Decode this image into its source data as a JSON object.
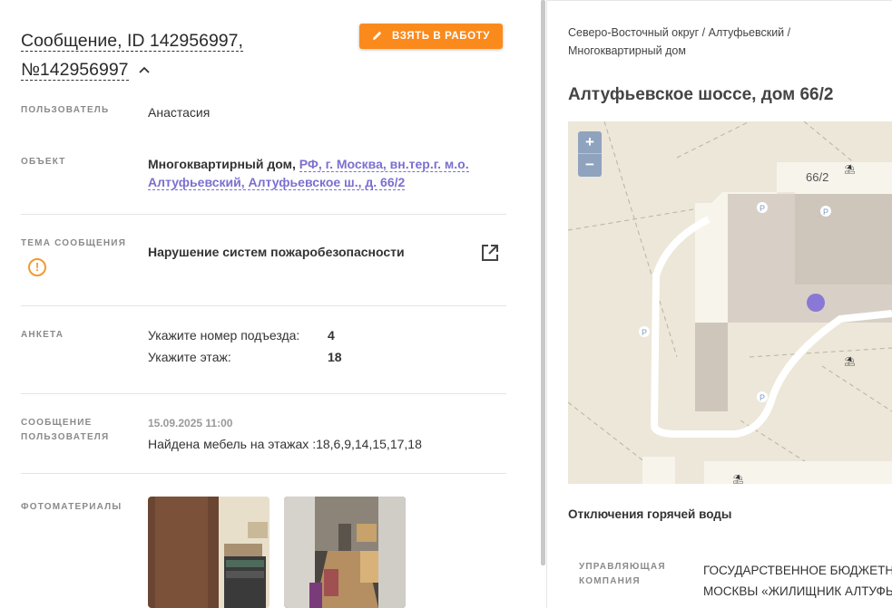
{
  "header": {
    "title_line1": "Сообщение, ID 142956997,",
    "title_line2": "№142956997",
    "take_button": "ВЗЯТЬ В РАБОТУ"
  },
  "fields": {
    "user_label": "ПОЛЬЗОВАТЕЛЬ",
    "user_value": "Анастасия",
    "object_label": "ОБЪЕКТ",
    "object_type": "Многоквартирный дом,",
    "object_link_line1": "РФ, г. Москва, вн.тер.г. м.о.",
    "object_link_line2": "Алтуфьевский, Алтуфьевское ш., д. 66/2",
    "topic_label": "ТЕМА СООБЩЕНИЯ",
    "topic_value": "Нарушение систем пожаробезопасности",
    "survey_label": "АНКЕТА",
    "survey": [
      {
        "q": "Укажите номер подъезда:",
        "a": "4"
      },
      {
        "q": "Укажите этаж:",
        "a": "18"
      }
    ],
    "message_label_line1": "СООБЩЕНИЕ",
    "message_label_line2": "ПОЛЬЗОВАТЕЛЯ",
    "message_date": "15.09.2025 11:00",
    "message_text": "Найдена мебель на этажах :18,6,9,14,15,17,18",
    "photos_label": "ФОТОМАТЕРИАЛЫ"
  },
  "right": {
    "breadcrumb_line1": "Северо-Восточный округ / Алтуфьевский /",
    "breadcrumb_line2": "Многоквартирный дом",
    "address": "Алтуфьевское шоссе, дом 66/2",
    "map": {
      "zoom_in": "+",
      "zoom_out": "−",
      "building_label": "66/2",
      "parking": "P"
    },
    "hot_water": "Отключения горячей воды",
    "mc_label_line1": "УПРАВЛЯЮЩАЯ",
    "mc_label_line2": "КОМПАНИЯ",
    "mc_value_line1": "ГОСУДАРСТВЕННОЕ БЮДЖЕТНОЕ",
    "mc_value_line2": "МОСКВЫ «ЖИЛИЩНИК АЛТУФЬ"
  },
  "colors": {
    "accent": "#fb8a1c",
    "link": "#7b6fd0",
    "warning": "#f29a30",
    "map_marker": "#8a78d6"
  },
  "icons": [
    "pencil-icon",
    "chevron-up-icon",
    "warning-circle-icon",
    "external-link-icon"
  ]
}
